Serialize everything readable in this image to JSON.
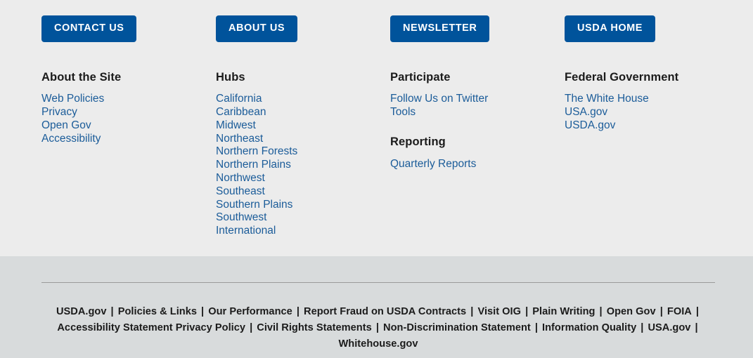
{
  "theme": {
    "upper_background": "#ececec",
    "lower_background": "#d8dbdc",
    "button_background": "#00539b",
    "button_text": "#ffffff",
    "link_color": "#1b5c99",
    "heading_color": "#1b1b1b",
    "divider_color": "#9a9a9a"
  },
  "columns": [
    {
      "button": "CONTACT US",
      "heading": "About the Site",
      "links": [
        "Web Policies",
        "Privacy",
        "Open Gov",
        "Accessibility"
      ]
    },
    {
      "button": "ABOUT US",
      "heading": "Hubs",
      "links": [
        "California",
        "Caribbean",
        "Midwest",
        "Northeast",
        "Northern Forests",
        "Northern Plains",
        "Northwest",
        "Southeast",
        "Southern Plains",
        "Southwest",
        "International"
      ]
    },
    {
      "button": "NEWSLETTER",
      "heading": "Participate",
      "links": [
        "Follow Us on Twitter",
        "Tools"
      ],
      "heading2": "Reporting",
      "links2": [
        "Quarterly Reports"
      ]
    },
    {
      "button": "USDA HOME",
      "heading": "Federal Government",
      "links": [
        "The White House",
        "USA.gov",
        "USDA.gov"
      ]
    }
  ],
  "legal": {
    "separator": "|",
    "items": [
      "USDA.gov",
      "Policies & Links",
      "Our Performance",
      "Report Fraud on USDA Contracts",
      "Visit OIG",
      "Plain Writing",
      "Open Gov",
      "FOIA",
      "Accessibility Statement Privacy Policy",
      "Civil Rights Statements",
      "Non-Discrimination Statement",
      "Information Quality",
      "USA.gov",
      "Whitehouse.gov"
    ]
  }
}
